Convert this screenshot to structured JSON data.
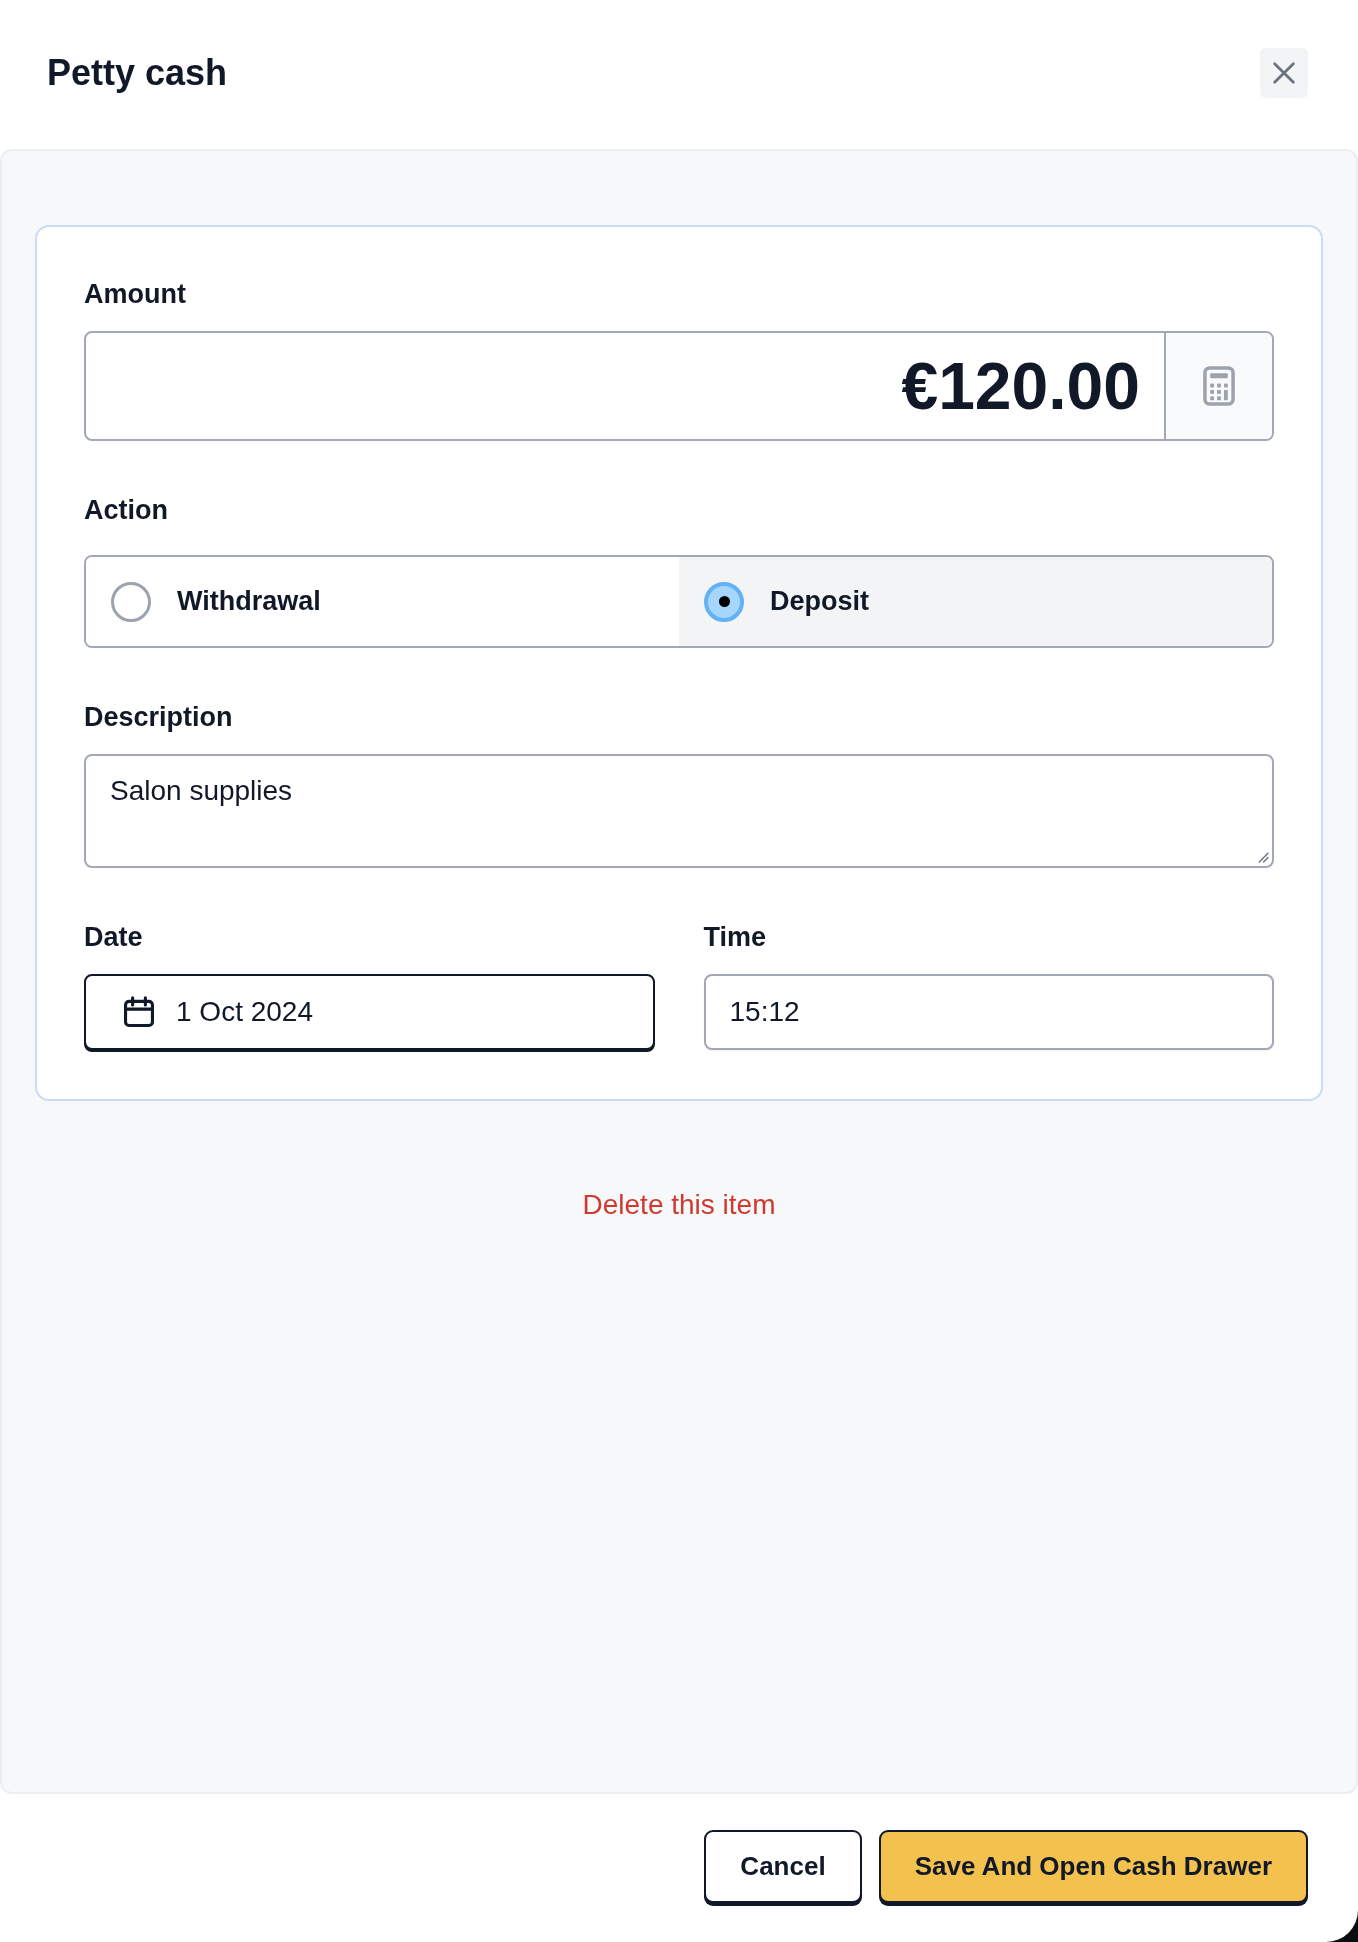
{
  "dialog": {
    "title": "Petty cash"
  },
  "form": {
    "amount": {
      "label": "Amount",
      "value": "€120.00"
    },
    "action": {
      "label": "Action",
      "options": [
        {
          "label": "Withdrawal",
          "selected": false
        },
        {
          "label": "Deposit",
          "selected": true
        }
      ]
    },
    "description": {
      "label": "Description",
      "value": "Salon supplies"
    },
    "date": {
      "label": "Date",
      "value": "1 Oct 2024",
      "focused": true
    },
    "time": {
      "label": "Time",
      "value": "15:12",
      "focused": false
    }
  },
  "delete_link": "Delete this item",
  "buttons": [
    {
      "label": "Cancel",
      "kind": "secondary"
    },
    {
      "label": "Save And Open Cash Drawer",
      "kind": "primary"
    }
  ]
}
